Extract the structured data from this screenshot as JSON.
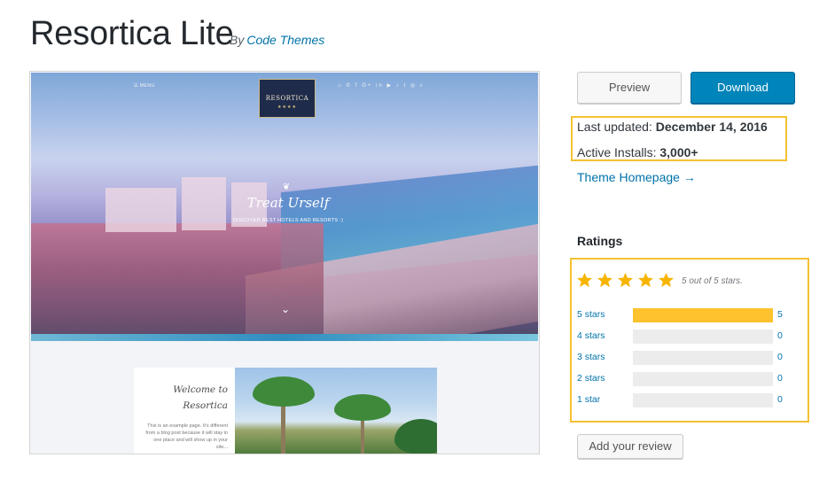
{
  "header": {
    "title": "Resortica Lite",
    "by_label": "By",
    "author": "Code Themes"
  },
  "preview": {
    "logo_text": "RESORTICA",
    "logo_stars": "★★★★",
    "menu_label": "☰ MENU",
    "social_icons": "⌂ ✆ f G+ in ▶ ♪ t ◎ ⌕",
    "hero_flourish": "❦",
    "hero_title": "Treat Urself",
    "hero_subtitle": "DISCOVER BEST HOTELS AND RESORTS :)",
    "hero_chevron": "⌄",
    "welcome_title": "Welcome to Resortica",
    "welcome_body": "This is an example page. It's different from a blog post because it will stay in one place and will show up in your site..."
  },
  "actions": {
    "preview_label": "Preview",
    "download_label": "Download"
  },
  "meta": {
    "last_updated_label": "Last updated:",
    "last_updated_value": "December 14, 2016",
    "active_installs_label": "Active Installs:",
    "active_installs_value": "3,000+",
    "theme_homepage_label": "Theme Homepage →"
  },
  "ratings": {
    "heading": "Ratings",
    "stars_caption": "5 out of 5 stars.",
    "star_color": "#f7b500",
    "bar_color": "#fdc22d",
    "average": 5,
    "max": 5,
    "rows": [
      {
        "label": "5 stars",
        "count": "5",
        "fraction": 1.0
      },
      {
        "label": "4 stars",
        "count": "0",
        "fraction": 0
      },
      {
        "label": "3 stars",
        "count": "0",
        "fraction": 0
      },
      {
        "label": "2 stars",
        "count": "0",
        "fraction": 0
      },
      {
        "label": "1 star",
        "count": "0",
        "fraction": 0
      }
    ],
    "add_review_label": "Add your review"
  },
  "highlight_color": "#f5c131",
  "accent_color": "#0085ba",
  "link_color": "#0073aa"
}
